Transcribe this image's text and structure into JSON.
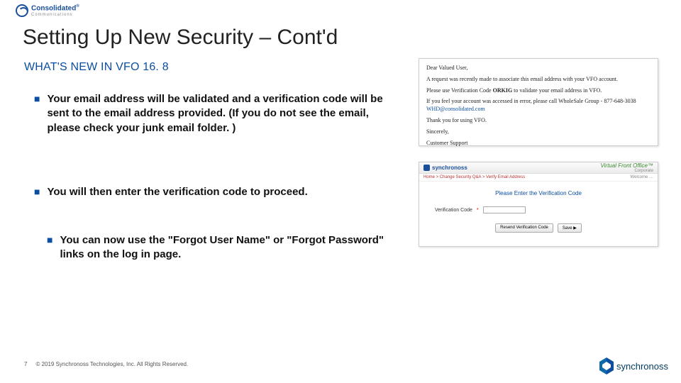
{
  "header": {
    "brand_top": "Consolidated",
    "brand_sub": "Communications",
    "brand_reg": "®"
  },
  "title": "Setting Up New Security – Cont'd",
  "subtitle": "WHAT'S NEW IN VFO 16. 8",
  "bullets": {
    "b1": "Your email address will be validated and a verification code will be sent to the email address provided.  (If you do not see the email, please check your junk email folder. )",
    "b2": "You will then enter the verification code to proceed.",
    "b3": "You can now use the \"Forgot User Name\" or \"Forgot Password\" links on the log in page."
  },
  "email": {
    "greeting": "Dear Valued User,",
    "p1": "A request was recently made to associate this email address with your VFO account.",
    "p2a": "Please use Verification Code ",
    "p2b": "ORKIG",
    "p2c": " to validate your email address in VFO.",
    "p3a": "If you feel your account was accessed in error, please call WholeSale Group - 877-648-3038 ",
    "p3b": "WHD@consolidated.com",
    "p4": "Thank you for using VFO.",
    "sign1": "Sincerely,",
    "sign2": "Customer Support"
  },
  "vfo": {
    "brand": "synchronoss",
    "product": "Virtual Front Office™",
    "corp": "Corporate",
    "crumb_left": "Home > Change Security Q&A > Verify Email Address",
    "crumb_right": "Welcome …",
    "prompt": "Please Enter the Verification Code",
    "label": "Verification Code",
    "star": "*",
    "btn_resend": "Resend Verification Code",
    "btn_save": "Save  ▶"
  },
  "footer": {
    "page": "7",
    "copyright": "© 2019 Synchronoss Technologies, Inc. All Rights Reserved.",
    "logo_text": "synchronoss"
  }
}
